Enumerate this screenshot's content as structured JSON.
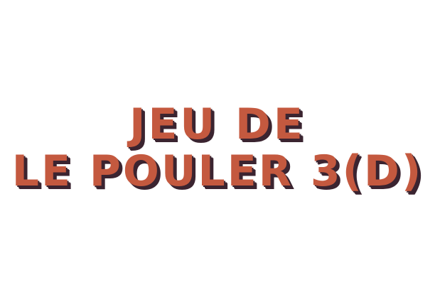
{
  "title": {
    "line1": "JEU DE",
    "line2": "LE POULER 3(D)"
  },
  "colors": {
    "title_fill": "#c4593f",
    "title_shadow": "#3b2430",
    "background": "#ffffff"
  }
}
